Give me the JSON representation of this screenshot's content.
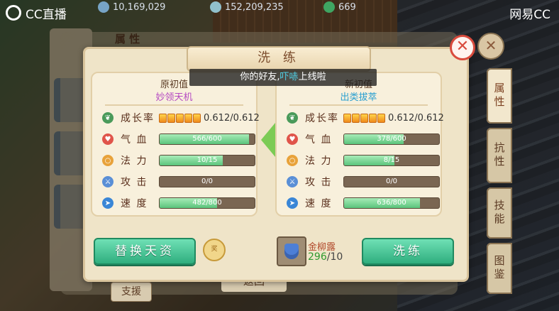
{
  "stream": {
    "logo_text": "CC直播",
    "watermark": "网易CC"
  },
  "resources": [
    {
      "value": "10,169,029",
      "icon": "coin-icon",
      "color": "#7fb0d8"
    },
    {
      "value": "152,209,235",
      "icon": "silver-icon",
      "color": "#9ad0e0"
    },
    {
      "value": "669",
      "icon": "jade-icon",
      "color": "#3fb36a"
    }
  ],
  "background": {
    "panel_title": "属 性",
    "back_button": "返回",
    "support_button": "支援",
    "side_tabs": [
      "属性",
      "抗性",
      "技能",
      "图鉴"
    ]
  },
  "dialog": {
    "title": "洗 练",
    "notice": {
      "prefix": "你的好友,",
      "name": "吓哧",
      "suffix": "上线啦"
    },
    "left_panel": {
      "heading": "原初值",
      "trait": "妙领天机",
      "growth": {
        "label": "成长率",
        "value": "0.612/0.612",
        "pips": 5
      },
      "stats": [
        {
          "label": "气 血",
          "text": "566/600",
          "fill": 0.943,
          "icon": "heart-icon",
          "color": "#e0544a"
        },
        {
          "label": "法 力",
          "text": "10/15",
          "fill": 0.667,
          "icon": "circle-icon",
          "color": "#e8a23a"
        },
        {
          "label": "攻 击",
          "text": "0/0",
          "fill": 0,
          "icon": "sword-icon",
          "color": "#5a8fd6"
        },
        {
          "label": "速 度",
          "text": "482/800",
          "fill": 0.6025,
          "icon": "speed-icon",
          "color": "#3a86d6"
        }
      ]
    },
    "right_panel": {
      "heading": "新初值",
      "trait": "出类拔萃",
      "growth": {
        "label": "成长率",
        "value": "0.612/0.612",
        "pips": 5
      },
      "stats": [
        {
          "label": "气 血",
          "text": "378/600",
          "fill": 0.63,
          "icon": "heart-icon",
          "color": "#e0544a"
        },
        {
          "label": "法 力",
          "text": "8/15",
          "fill": 0.533,
          "icon": "circle-icon",
          "color": "#e8a23a"
        },
        {
          "label": "攻 击",
          "text": "0/0",
          "fill": 0,
          "icon": "sword-icon",
          "color": "#5a8fd6"
        },
        {
          "label": "速 度",
          "text": "636/800",
          "fill": 0.795,
          "icon": "speed-icon",
          "color": "#3a86d6"
        }
      ]
    },
    "replace_button": "替换天资",
    "medal_label": "奖",
    "item": {
      "name": "金柳露",
      "have": "296",
      "need": "/10"
    },
    "refine_button": "洗练",
    "close_symbol": "✕"
  }
}
